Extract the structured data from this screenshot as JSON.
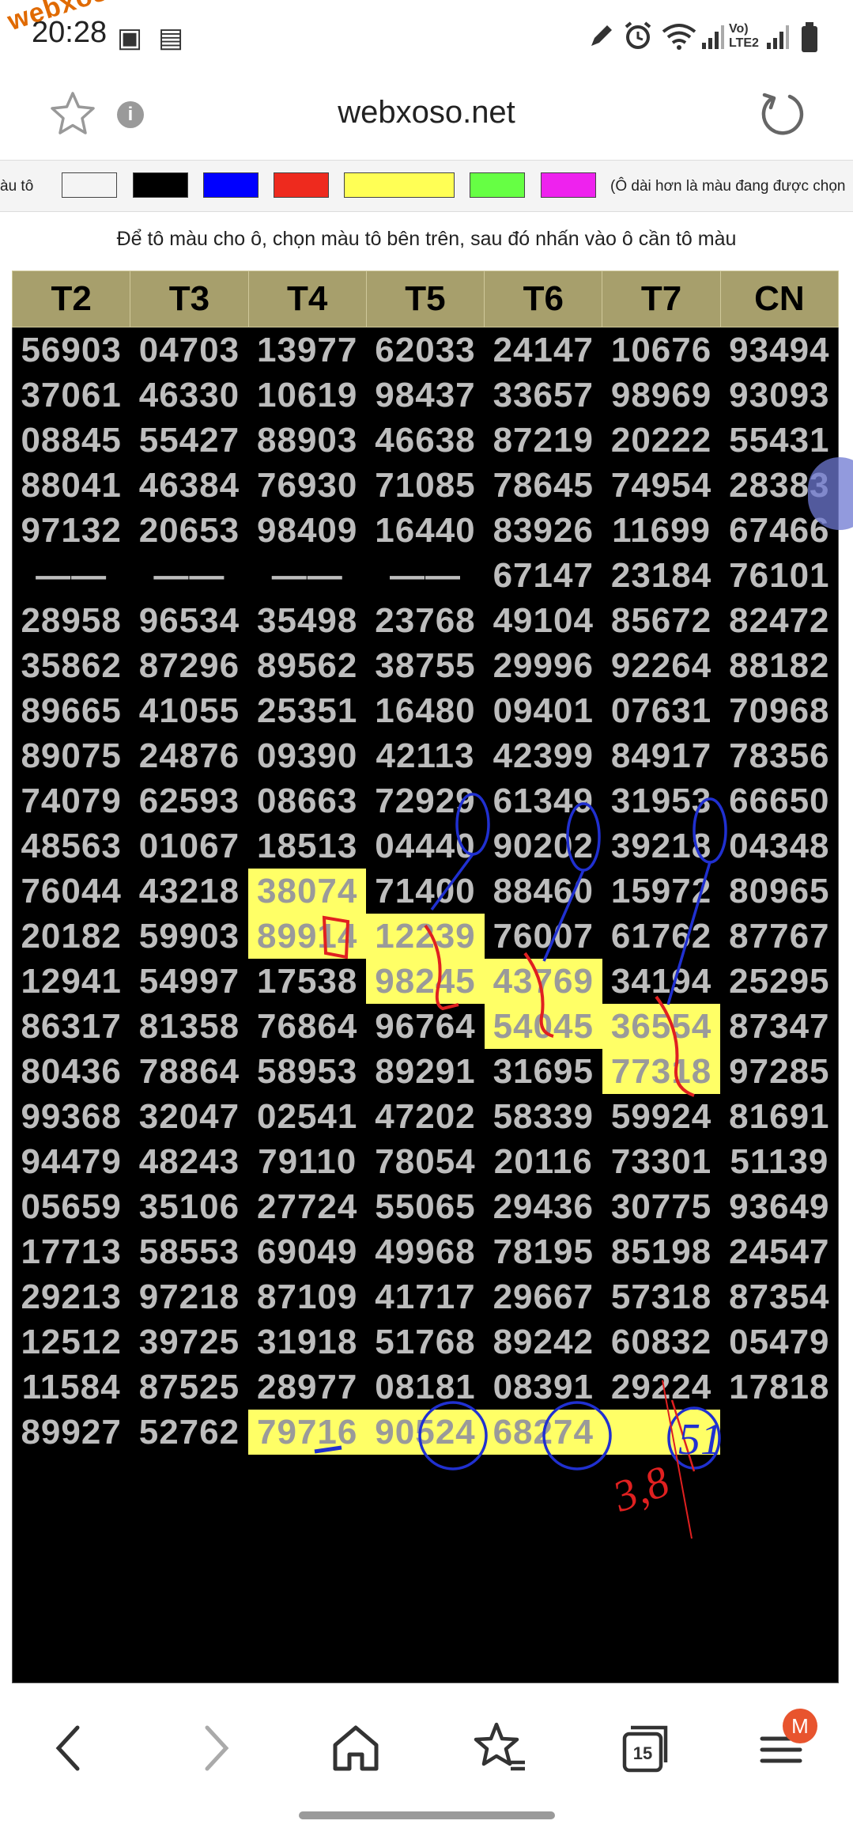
{
  "status_bar": {
    "time": "20:28",
    "watermark": "webxoso.net",
    "network": [
      "Vo)",
      "LTE2"
    ]
  },
  "browser": {
    "url": "webxoso.net",
    "info_icon": "i",
    "tab_count": "15",
    "profile_badge": "M"
  },
  "colorbar": {
    "label": "àu tô",
    "swatches": [
      "#ffffff",
      "#000000",
      "#0000ff",
      "#ee2a1e",
      "#ffff55",
      "#66ff44",
      "#ee22ee"
    ],
    "hint": "(Ô dài hơn là màu đang được chọn"
  },
  "instruction": "Để tô màu cho ô, chọn màu tô bên trên, sau đó nhấn vào ô cần tô màu",
  "table": {
    "headers": [
      "T2",
      "T3",
      "T4",
      "T5",
      "T6",
      "T7",
      "CN"
    ],
    "rows": [
      [
        "56903",
        "04703",
        "13977",
        "62033",
        "24147",
        "10676",
        "93494"
      ],
      [
        "37061",
        "46330",
        "10619",
        "98437",
        "33657",
        "98969",
        "93093"
      ],
      [
        "08845",
        "55427",
        "88903",
        "46638",
        "87219",
        "20222",
        "55431"
      ],
      [
        "88041",
        "46384",
        "76930",
        "71085",
        "78645",
        "74954",
        "28383"
      ],
      [
        "97132",
        "20653",
        "98409",
        "16440",
        "83926",
        "11699",
        "67466"
      ],
      [
        "——",
        "——",
        "——",
        "——",
        "67147",
        "23184",
        "76101"
      ],
      [
        "28958",
        "96534",
        "35498",
        "23768",
        "49104",
        "85672",
        "82472"
      ],
      [
        "35862",
        "87296",
        "89562",
        "38755",
        "29996",
        "92264",
        "88182"
      ],
      [
        "89665",
        "41055",
        "25351",
        "16480",
        "09401",
        "07631",
        "70968"
      ],
      [
        "89075",
        "24876",
        "09390",
        "42113",
        "42399",
        "84917",
        "78356"
      ],
      [
        "74079",
        "62593",
        "08663",
        "72929",
        "61349",
        "31953",
        "66650"
      ],
      [
        "48563",
        "01067",
        "18513",
        "04440",
        "90202",
        "39218",
        "04348"
      ],
      [
        "76044",
        "43218",
        "38074",
        "71400",
        "88460",
        "15972",
        "80965"
      ],
      [
        "20182",
        "59903",
        "89914",
        "12239",
        "76007",
        "61762",
        "87767"
      ],
      [
        "12941",
        "54997",
        "17538",
        "98245",
        "43769",
        "34194",
        "25295"
      ],
      [
        "86317",
        "81358",
        "76864",
        "96764",
        "54045",
        "36554",
        "87347"
      ],
      [
        "80436",
        "78864",
        "58953",
        "89291",
        "31695",
        "77318",
        "97285"
      ],
      [
        "99368",
        "32047",
        "02541",
        "47202",
        "58339",
        "59924",
        "81691"
      ],
      [
        "94479",
        "48243",
        "79110",
        "78054",
        "20116",
        "73301",
        "51139"
      ],
      [
        "05659",
        "35106",
        "27724",
        "55065",
        "29436",
        "30775",
        "93649"
      ],
      [
        "17713",
        "58553",
        "69049",
        "49968",
        "78195",
        "85198",
        "24547"
      ],
      [
        "29213",
        "97218",
        "87109",
        "41717",
        "29667",
        "57318",
        "87354"
      ],
      [
        "12512",
        "39725",
        "31918",
        "51768",
        "89242",
        "60832",
        "05479"
      ],
      [
        "11584",
        "87525",
        "28977",
        "08181",
        "08391",
        "29224",
        "17818"
      ],
      [
        "89927",
        "52762",
        "79716",
        "90524",
        "68274",
        "",
        ""
      ]
    ],
    "highlight_color": "#ffff66"
  },
  "annotations": {
    "handwritten": [
      "3,8",
      "51"
    ]
  }
}
